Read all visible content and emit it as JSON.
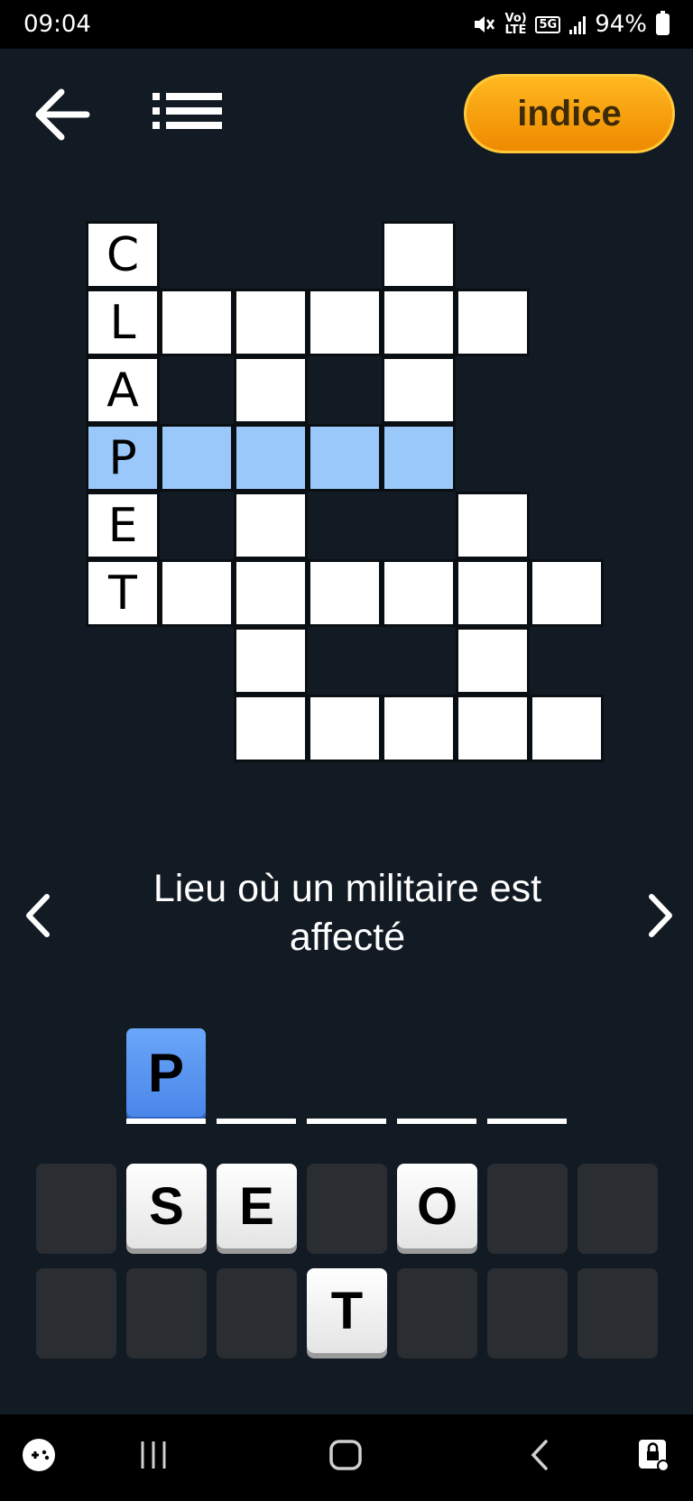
{
  "status_bar": {
    "time": "09:04",
    "volte_label": "Vo) LTE",
    "network_label": "5G",
    "battery": "94%"
  },
  "toolbar": {
    "hint_label": "indice"
  },
  "grid": {
    "letters": {
      "c": "C",
      "l": "L",
      "a": "A",
      "p": "P",
      "e": "E",
      "t": "T"
    }
  },
  "clue": {
    "text": "Lieu où un militaire est affecté"
  },
  "answer": {
    "tiles": [
      "P"
    ]
  },
  "letter_keys": {
    "row1": [
      "S",
      "E",
      "O"
    ],
    "row2": [
      "T"
    ]
  },
  "colors": {
    "background": "#121a23",
    "highlight": "#9bc8fb",
    "hint": "#f5a300",
    "selected_tile": "#4a86e8"
  }
}
